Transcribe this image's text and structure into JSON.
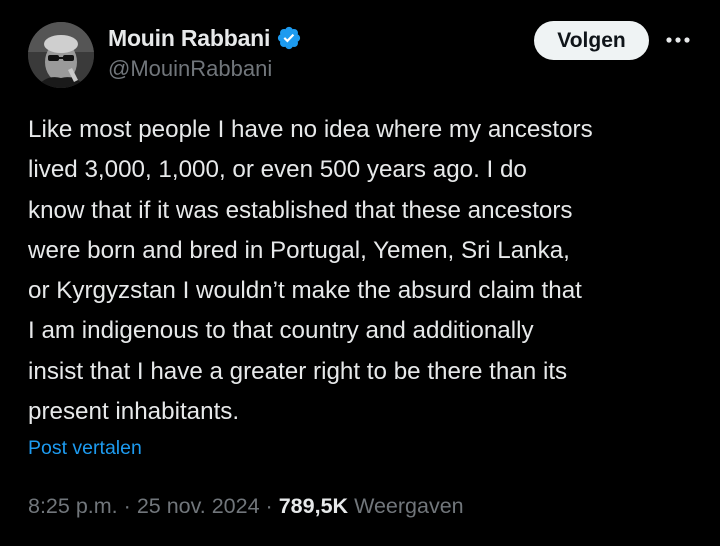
{
  "author": {
    "display_name": "Mouin Rabbani",
    "handle": "@MouinRabbani",
    "verified": true
  },
  "follow_button": {
    "label": "Volgen"
  },
  "more_icon": "more-dots-icon",
  "tweet": {
    "text": "Like most people I have no idea where my ancestors\nlived 3,000, 1,000, or even 500 years ago. I do\nknow that if it was established that these ancestors\nwere born and bred in Portugal, Yemen, Sri Lanka,\nor Kyrgyzstan I wouldn’t make the absurd claim that\nI am indigenous to that country and additionally\ninsist that I have a greater right to be there than its\npresent inhabitants.",
    "translate_label": "Post vertalen"
  },
  "meta": {
    "time": "8:25 p.m.",
    "separator": "·",
    "date": "25 nov. 2024",
    "views_count": "789,5K",
    "views_label": "Weergaven"
  },
  "colors": {
    "background": "#000000",
    "text_primary": "#e7e9ea",
    "text_secondary": "#71767b",
    "accent": "#1d9bf0",
    "button_bg": "#eff3f4"
  }
}
